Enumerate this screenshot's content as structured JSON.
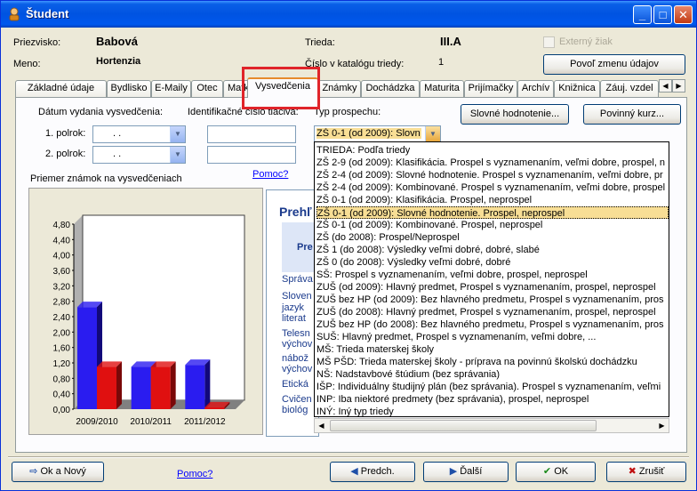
{
  "window": {
    "title": "Študent"
  },
  "header": {
    "priezvisko_label": "Priezvisko:",
    "priezvisko": "Babová",
    "meno_label": "Meno:",
    "meno": "Hortenzia",
    "trieda_label": "Trieda:",
    "trieda": "III.A",
    "katalog_label": "Číslo v katalógu triedy:",
    "katalog": "1",
    "externy_label": "Externý žiak",
    "povol_button": "Povoľ zmenu údajov"
  },
  "tabs": [
    "Základné údaje",
    "Bydlisko",
    "E-Maily",
    "Otec",
    "Matka",
    "Vysvedčenia",
    "Známky",
    "Dochádzka",
    "Maturita",
    "Prijímačky",
    "Archív",
    "Knižnica",
    "Záuj. vzdel"
  ],
  "form": {
    "datum_label": "Dátum vydania vysvedčenia:",
    "ident_label": "Identifikačné číslo tlačiva:",
    "typ_label": "Typ prospechu:",
    "polrok1": "1. polrok:",
    "polrok2": "2. polrok:",
    "date_placeholder": ".   .",
    "typ_value": "ZŠ 0-1 (od 2009): Slovn",
    "slovne_button": "Slovné hodnotenie...",
    "povinny_button": "Povinný kurz...",
    "pomoc_link": "Pomoc?",
    "priemer_label": "Priemer známok na vysvedčeniach"
  },
  "chart_data": {
    "type": "bar",
    "categories": [
      "2009/2010",
      "2010/2011",
      "2011/2012"
    ],
    "series": [
      {
        "color": "#2a1cf0",
        "values": [
          2.65,
          1.1,
          1.15
        ]
      },
      {
        "color": "#e01010",
        "values": [
          1.1,
          1.1,
          0.05
        ]
      }
    ],
    "ylim": [
      0,
      4.8
    ],
    "yticks": [
      "0,00",
      "0,40",
      "0,80",
      "1,20",
      "1,60",
      "2,00",
      "2,40",
      "2,80",
      "3,20",
      "3,60",
      "4,00",
      "4,40",
      "4,80"
    ]
  },
  "web_preview": {
    "title": "Prehľ",
    "header_cell": "Pre",
    "lines": [
      "Správa",
      "Sloven",
      "jazyk",
      "literat",
      "Telesn",
      "výchov",
      "nábož",
      "výchov",
      "Etická",
      "Cvičen",
      "biológ"
    ]
  },
  "dropdown": {
    "items": [
      "TRIEDA: Podľa triedy",
      "ZŠ 2-9 (od 2009): Klasifikácia. Prospel s vyznamenaním, veľmi dobre, prospel, n",
      "ZŠ 2-4 (od 2009): Slovné hodnotenie. Prospel s vyznamenaním, veľmi dobre, pr",
      "ZŠ 2-4 (od 2009): Kombinované. Prospel s vyznamenaním, veľmi dobre, prospel",
      "ZŠ 0-1 (od 2009): Klasifikácia. Prospel, neprospel",
      "ZŠ 0-1 (od 2009): Slovné hodnotenie. Prospel, neprospel",
      "ZŠ 0-1 (od 2009): Kombinované. Prospel, neprospel",
      "ZŠ (do 2008): Prospel/Neprospel",
      "ZŠ 1 (do 2008): Výsledky veľmi dobré, dobré, slabé",
      "ZŠ 0 (do 2008): Výsledky veľmi dobré, dobré",
      "SŠ: Prospel s vyznamenaním, veľmi dobre, prospel, neprospel",
      "ZUŠ (od 2009): Hlavný predmet, Prospel s vyznamenaním, prospel, neprospel",
      "ZUŠ bez HP (od 2009): Bez hlavného predmetu, Prospel s vyznamenaním, pros",
      "ZUŠ (do 2008): Hlavný predmet, Prospel s vyznamenaním, prospel, neprospel",
      "ZUŠ bez HP (do 2008): Bez hlavného predmetu, Prospel s vyznamenaním, pros",
      "SUŠ: Hlavný predmet, Prospel s vyznamenaním, veľmi dobre, ...",
      "MŠ: Trieda materskej školy",
      "MŠ PŠD: Trieda materskej školy - príprava na povinnú školskú dochádzku",
      "NŠ: Nadstavbové štúdium (bez správania)",
      "IŠP: Individuálny študijný plán (bez správania). Prospel s vyznamenaním, veľmi",
      "INP: Iba niektoré predmety (bez správania), prospel, neprospel",
      "INÝ: Iný typ triedy"
    ],
    "selected_index": 5
  },
  "footer": {
    "ok_novy": "Ok a Nový",
    "pomoc": "Pomoc?",
    "predch": "Predch.",
    "dalsi": "Ďalší",
    "ok": "OK",
    "zrusit": "Zrušiť"
  }
}
